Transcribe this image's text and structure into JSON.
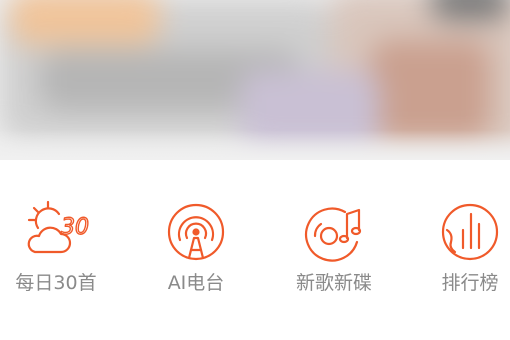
{
  "colors": {
    "accent": "#f05a2a",
    "label": "#8a8a8a",
    "background": "#ffffff"
  },
  "banner": {
    "icon": "blurred-banner-image"
  },
  "quick_nav": [
    {
      "label": "每日30首",
      "icon": "daily-sun-cloud-icon",
      "badge": "30"
    },
    {
      "label": "AI电台",
      "icon": "radio-broadcast-icon"
    },
    {
      "label": "新歌新碟",
      "icon": "vinyl-music-note-icon"
    },
    {
      "label": "排行榜",
      "icon": "chart-ranking-icon"
    }
  ]
}
